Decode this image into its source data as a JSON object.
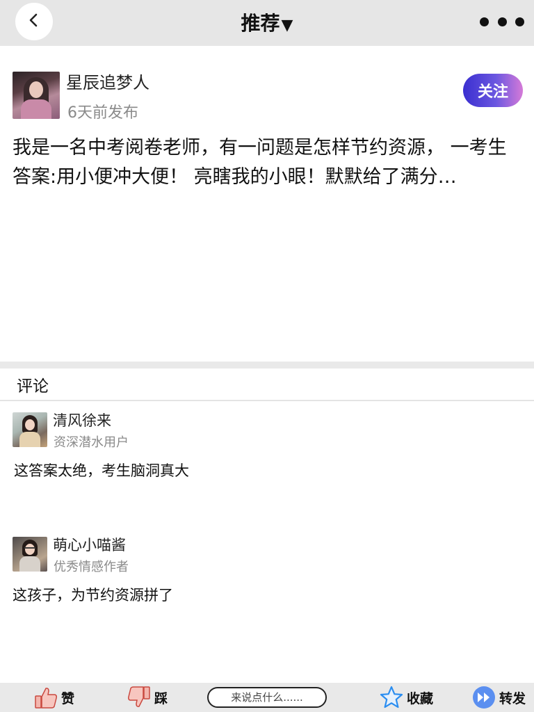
{
  "navbar": {
    "title": "推荐",
    "title_caret": "▼"
  },
  "post": {
    "author": "星辰追梦人",
    "time": "6天前发布",
    "follow_label": "关注",
    "body": "我是一名中考阅卷老师，有一问题是怎样节约资源， 一考生答案:用小便冲大便！ 亮瞎我的小眼！默默给了满分…"
  },
  "comments_section": {
    "heading": "评论",
    "items": [
      {
        "name": "清风徐来",
        "title": "资深潜水用户",
        "text": "这答案太绝，考生脑洞真大"
      },
      {
        "name": "萌心小喵酱",
        "title": "优秀情感作者",
        "text": "这孩子，为节约资源拼了"
      }
    ]
  },
  "toolbar": {
    "like_label": "赞",
    "dislike_label": "踩",
    "input_placeholder": "来说点什么......",
    "favorite_label": "收藏",
    "share_label": "转发"
  },
  "colors": {
    "follow_gradient_start": "#3a2fd0",
    "follow_gradient_end": "#d57ad8",
    "star_blue": "#2a8df0",
    "share_blue": "#5b8ff0",
    "thumb_red": "#e0524a"
  },
  "icons": {
    "back": "chevron-left-icon",
    "more": "more-dots-icon",
    "like": "thumbs-up-icon",
    "dislike": "thumbs-down-icon",
    "favorite": "star-icon",
    "share": "forward-icon"
  }
}
